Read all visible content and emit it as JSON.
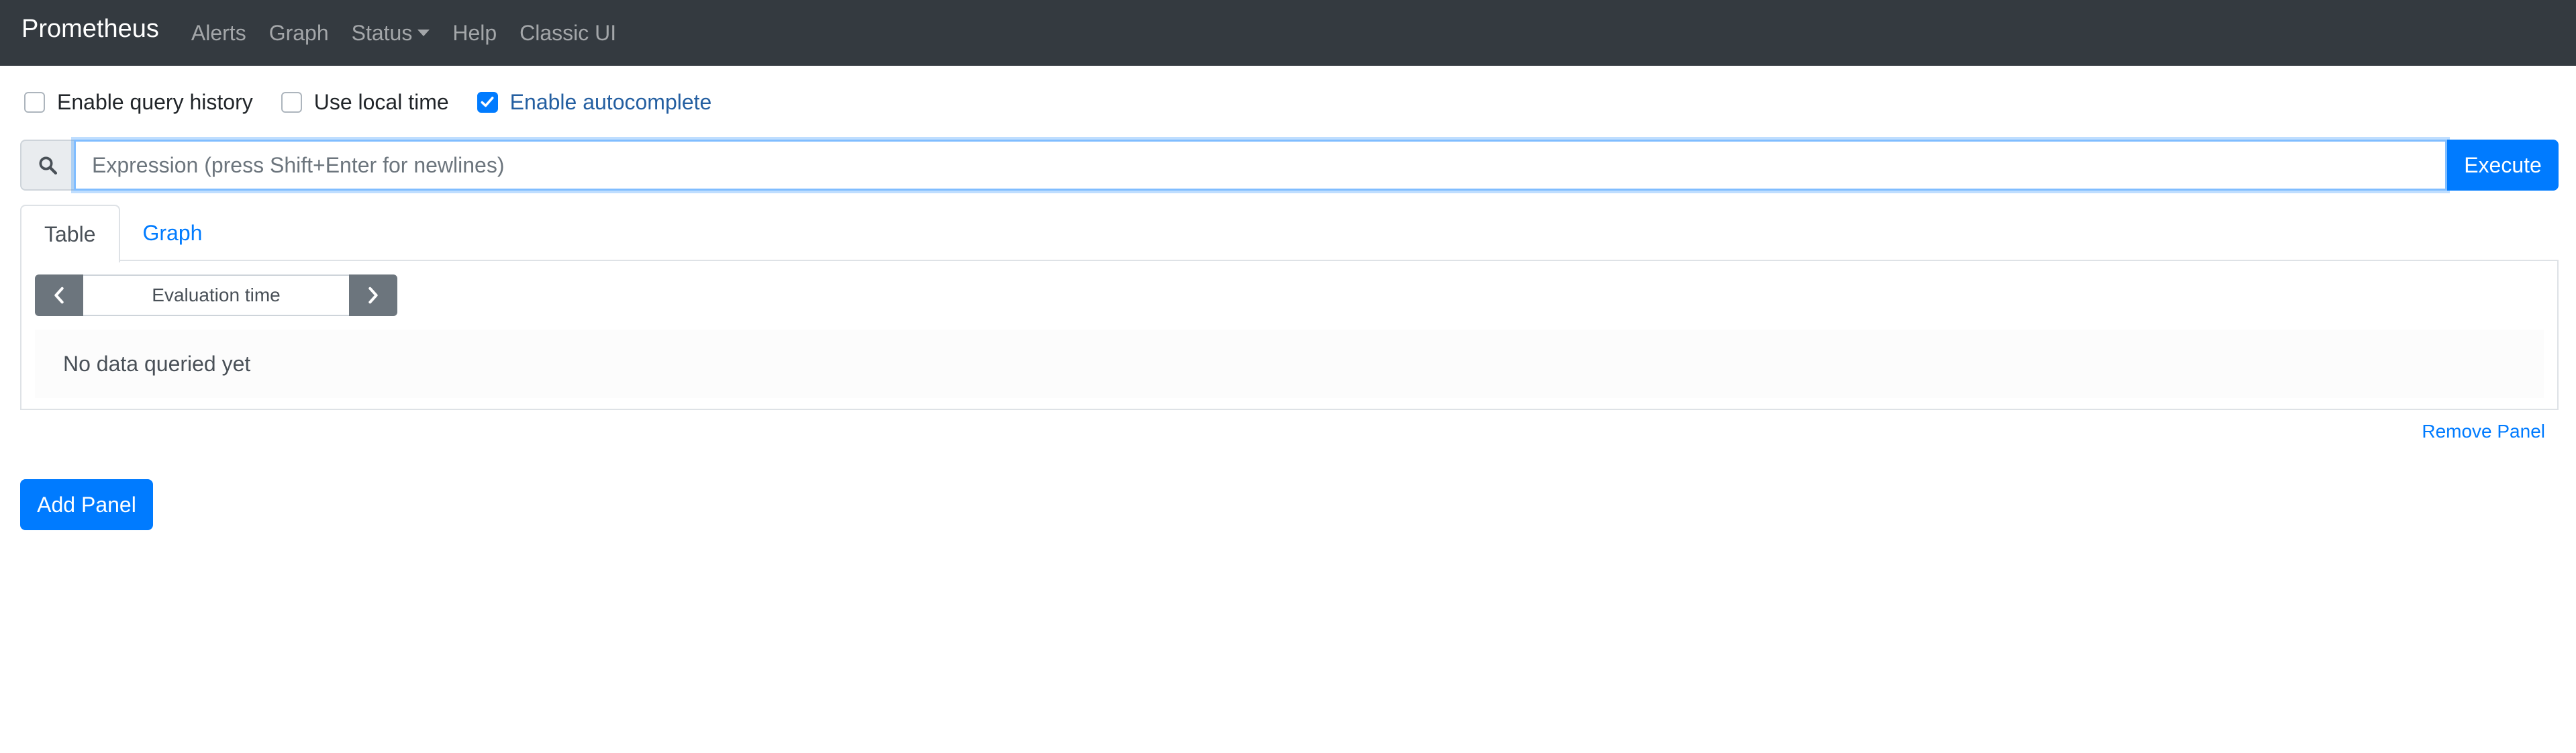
{
  "navbar": {
    "brand": "Prometheus",
    "links": [
      {
        "label": "Alerts"
      },
      {
        "label": "Graph"
      },
      {
        "label": "Status"
      },
      {
        "label": "Help"
      },
      {
        "label": "Classic UI"
      }
    ]
  },
  "options": {
    "query_history": {
      "label": "Enable query history",
      "checked": false
    },
    "local_time": {
      "label": "Use local time",
      "checked": false
    },
    "autocomplete": {
      "label": "Enable autocomplete",
      "checked": true
    }
  },
  "expression": {
    "placeholder": "Expression (press Shift+Enter for newlines)",
    "value": "",
    "execute_label": "Execute",
    "prepend_icon": "search-icon"
  },
  "panel": {
    "tabs": [
      {
        "label": "Table",
        "active": true
      },
      {
        "label": "Graph",
        "active": false
      }
    ],
    "evaluation_time_placeholder": "Evaluation time",
    "prev_icon": "chevron-left-icon",
    "next_icon": "chevron-right-icon",
    "empty_message": "No data queried yet",
    "remove_label": "Remove Panel"
  },
  "actions": {
    "add_panel_label": "Add Panel"
  },
  "colors": {
    "navbar_bg": "#343a40",
    "primary": "#007bff",
    "secondary": "#6c757d"
  }
}
